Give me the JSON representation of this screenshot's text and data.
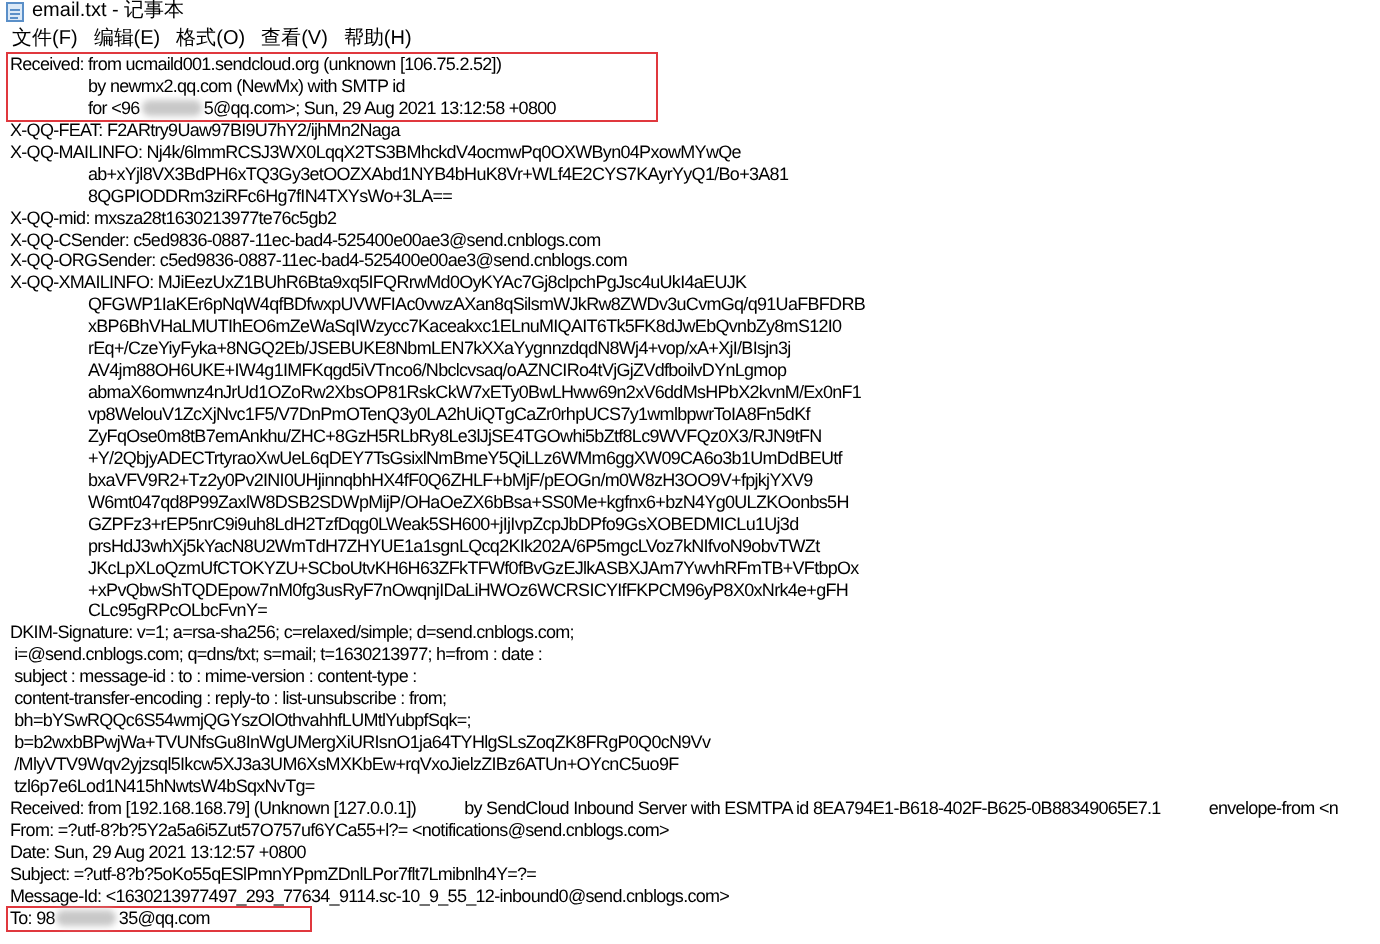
{
  "window": {
    "title": "email.txt - 记事本"
  },
  "menu": [
    "文件(F)",
    "编辑(E)",
    "格式(O)",
    "查看(V)",
    "帮助(H)"
  ],
  "blocks": [
    {
      "highlighted": true,
      "lines": [
        {
          "kind": "field",
          "parts": [
            {
              "kind": "text",
              "text": "Received: from ucmaild001.sendcloud.org (unknown [106.75.2.52])"
            }
          ]
        },
        {
          "kind": "continuation",
          "parts": [
            {
              "kind": "text",
              "text": "by newmx2.qq.com (NewMx) with SMTP id"
            }
          ]
        },
        {
          "kind": "continuation",
          "parts": [
            {
              "kind": "text",
              "text": "for <96"
            },
            {
              "kind": "redacted"
            },
            {
              "kind": "text",
              "text": "5@qq.com>; Sun, 29 Aug 2021 13:12:58 +0800"
            }
          ]
        }
      ]
    },
    {
      "highlighted": false,
      "lines": [
        {
          "kind": "field",
          "parts": [
            {
              "kind": "text",
              "text": "X-QQ-FEAT: F2ARtry9Uaw97BI9U7hY2/ijhMn2Naga"
            }
          ]
        },
        {
          "kind": "field",
          "parts": [
            {
              "kind": "text",
              "text": "X-QQ-MAILINFO: Nj4k/6lmmRCSJ3WX0LqqX2TS3BMhckdV4ocmwPq0OXWByn04PxowMYwQe"
            }
          ]
        },
        {
          "kind": "continuation",
          "parts": [
            {
              "kind": "text",
              "text": "ab+xYjl8VX3BdPH6xTQ3Gy3etOOZXAbd1NYB4bHuK8Vr+WLf4E2CYS7KAyrYyQ1/Bo+3A81"
            }
          ]
        },
        {
          "kind": "continuation",
          "parts": [
            {
              "kind": "text",
              "text": "8QGPIODDRm3ziRFc6Hg7fIN4TXYsWo+3LA=="
            }
          ]
        },
        {
          "kind": "field",
          "parts": [
            {
              "kind": "text",
              "text": "X-QQ-mid: mxsza28t1630213977te76c5gb2"
            }
          ]
        },
        {
          "kind": "field",
          "parts": [
            {
              "kind": "text",
              "text": "X-QQ-CSender: c5ed9836-0887-11ec-bad4-525400e00ae3@send.cnblogs.com"
            }
          ]
        },
        {
          "kind": "field",
          "parts": [
            {
              "kind": "text",
              "text": "X-QQ-ORGSender: c5ed9836-0887-11ec-bad4-525400e00ae3@send.cnblogs.com"
            }
          ]
        },
        {
          "kind": "field",
          "parts": [
            {
              "kind": "text",
              "text": "X-QQ-XMAILINFO: MJiEezUxZ1BUhR6Bta9xq5IFQRrwMd0OyKYAc7Gj8clpchPgJsc4uUkI4aEUJK"
            }
          ]
        },
        {
          "kind": "continuation",
          "parts": [
            {
              "kind": "text",
              "text": "QFGWP1IaKEr6pNqW4qfBDfwxpUVWFIAc0vwzAXan8qSilsmWJkRw8ZWDv3uCvmGq/q91UaFBFDRB"
            }
          ]
        },
        {
          "kind": "continuation",
          "parts": [
            {
              "kind": "text",
              "text": "xBP6BhVHaLMUTIhEO6mZeWaSqIWzycc7Kaceakxc1ELnuMIQAIT6Tk5FK8dJwEbQvnbZy8mS12I0"
            }
          ]
        },
        {
          "kind": "continuation",
          "parts": [
            {
              "kind": "text",
              "text": "rEq+/CzeYiyFyka+8NGQ2Eb/JSEBUKE8NbmLEN7kXXaYygnnzdqdN8Wj4+vop/xA+XjI/BIsjn3j"
            }
          ]
        },
        {
          "kind": "continuation",
          "parts": [
            {
              "kind": "text",
              "text": "AV4jm88OH6UKE+IW4g1IMFKqgd5iVTnco6/Nbclcvsaq/oAZNCIRo4tVjGjZVdfboilvDYnLgmop"
            }
          ]
        },
        {
          "kind": "continuation",
          "parts": [
            {
              "kind": "text",
              "text": "abmaX6omwnz4nJrUd1OZoRw2XbsOP81RskCkW7xETy0BwLHww69n2xV6ddMsHPbX2kvnM/Ex0nF1"
            }
          ]
        },
        {
          "kind": "continuation",
          "parts": [
            {
              "kind": "text",
              "text": "vp8WelouV1ZcXjNvc1F5/V7DnPmOTenQ3y0LA2hUiQTgCaZr0rhpUCS7y1wmlbpwrToIA8Fn5dKf"
            }
          ]
        },
        {
          "kind": "continuation",
          "parts": [
            {
              "kind": "text",
              "text": "ZyFqOse0m8tB7emAnkhu/ZHC+8GzH5RLbRy8Le3lJjSE4TGOwhi5bZtf8Lc9WVFQz0X3/RJN9tFN"
            }
          ]
        },
        {
          "kind": "continuation",
          "parts": [
            {
              "kind": "text",
              "text": "+Y/2QbjyADECTrtyraoXwUeL6qDEY7TsGsixlNmBmeY5QiLLz6WMm6ggXW09CA6o3b1UmDdBEUtf"
            }
          ]
        },
        {
          "kind": "continuation",
          "parts": [
            {
              "kind": "text",
              "text": "bxaVFV9R2+Tz2y0Pv2INI0UHjinnqbhHX4fF0Q6ZHLF+bMjF/pEOGn/m0W8zH3OO9V+fpjkjYXV9"
            }
          ]
        },
        {
          "kind": "continuation",
          "parts": [
            {
              "kind": "text",
              "text": "W6mt047qd8P99ZaxlW8DSB2SDWpMijP/OHaOeZX6bBsa+SS0Me+kgfnx6+bzN4Yg0ULZKOonbs5H"
            }
          ]
        },
        {
          "kind": "continuation",
          "parts": [
            {
              "kind": "text",
              "text": "GZPFz3+rEP5nrC9i9uh8LdH2TzfDqg0LWeak5SH600+jIjIvpZcpJbDPfo9GsXOBEDMICLu1Uj3d"
            }
          ]
        },
        {
          "kind": "continuation",
          "parts": [
            {
              "kind": "text",
              "text": "prsHdJ3whXj5kYacN8U2WmTdH7ZHYUE1a1sgnLQcq2KIk202A/6P5mgcLVoz7kNIfvoN9obvTWZt"
            }
          ]
        },
        {
          "kind": "continuation",
          "parts": [
            {
              "kind": "text",
              "text": "JKcLpXLoQzmUfCTOKYZU+SCboUtvKH6H63ZFkTFWf0fBvGzEJlkASBXJAm7YwvhRFmTB+VFtbpOx"
            }
          ]
        },
        {
          "kind": "continuation",
          "parts": [
            {
              "kind": "text",
              "text": "+xPvQbwShTQDEpow7nM0fg3usRyF7nOwqnjIDaLiHWOz6WCRSICYIfFKPCM96yP8X0xNrk4e+gFH"
            }
          ]
        },
        {
          "kind": "continuation",
          "parts": [
            {
              "kind": "text",
              "text": "CLc95gRPcOLbcFvnY="
            }
          ]
        },
        {
          "kind": "field",
          "parts": [
            {
              "kind": "text",
              "text": "DKIM-Signature: v=1; a=rsa-sha256; c=relaxed/simple; d=send.cnblogs.com;"
            }
          ]
        },
        {
          "kind": "field",
          "parts": [
            {
              "kind": "text",
              "text": " i=@send.cnblogs.com; q=dns/txt; s=mail; t=1630213977; h=from : date :"
            }
          ]
        },
        {
          "kind": "field",
          "parts": [
            {
              "kind": "text",
              "text": " subject : message-id : to : mime-version : content-type :"
            }
          ]
        },
        {
          "kind": "field",
          "parts": [
            {
              "kind": "text",
              "text": " content-transfer-encoding : reply-to : list-unsubscribe : from;"
            }
          ]
        },
        {
          "kind": "field",
          "parts": [
            {
              "kind": "text",
              "text": " bh=bYSwRQQc6S54wmjQGYszOlOthvahhfLUMtlYubpfSqk=;"
            }
          ]
        },
        {
          "kind": "field",
          "parts": [
            {
              "kind": "text",
              "text": " b=b2wxbBPwjWa+TVUNfsGu8InWgUMergXiURIsnO1ja64TYHlgSLsZoqZK8FRgP0Q0cN9Vv"
            }
          ]
        },
        {
          "kind": "field",
          "parts": [
            {
              "kind": "text",
              "text": " /MlyVTV9Wqv2yjzsql5Ikcw5XJ3a3UM6XsMXKbEw+rqVxoJielzZIBz6ATUn+OYcnC5uo9F"
            }
          ]
        },
        {
          "kind": "field",
          "parts": [
            {
              "kind": "text",
              "text": " tzl6p7e6Lod1N415hNwtsW4bSqxNvTg="
            }
          ]
        },
        {
          "kind": "field",
          "parts": [
            {
              "kind": "text",
              "text": "Received: from [192.168.168.79] (Unknown [127.0.0.1])"
            },
            {
              "kind": "tab"
            },
            {
              "kind": "text",
              "text": "by SendCloud Inbound Server with ESMTPA id 8EA794E1-B618-402F-B625-0B88349065E7.1"
            },
            {
              "kind": "tab"
            },
            {
              "kind": "text",
              "text": "envelope-from <n"
            }
          ]
        },
        {
          "kind": "field",
          "parts": [
            {
              "kind": "text",
              "text": "From: =?utf-8?b?5Y2a5a6i5Zut57O757uf6YCa55+l?= <notifications@send.cnblogs.com>"
            }
          ]
        },
        {
          "kind": "field",
          "parts": [
            {
              "kind": "text",
              "text": "Date: Sun, 29 Aug 2021 13:12:57 +0800"
            }
          ]
        },
        {
          "kind": "field",
          "parts": [
            {
              "kind": "text",
              "text": "Subject: =?utf-8?b?5oKo55qESlPmnYPpmZDnlLPor7flt7Lmibnlh4Y=?="
            }
          ]
        },
        {
          "kind": "field",
          "parts": [
            {
              "kind": "text",
              "text": "Message-Id: <1630213977497_293_77634_9114.sc-10_9_55_12-inbound0@send.cnblogs.com>"
            }
          ]
        }
      ]
    },
    {
      "highlighted": true,
      "lines": [
        {
          "kind": "field",
          "parts": [
            {
              "kind": "text",
              "text": "To: 98"
            },
            {
              "kind": "redacted"
            },
            {
              "kind": "text",
              "text": "35@qq.com"
            }
          ]
        }
      ]
    }
  ]
}
